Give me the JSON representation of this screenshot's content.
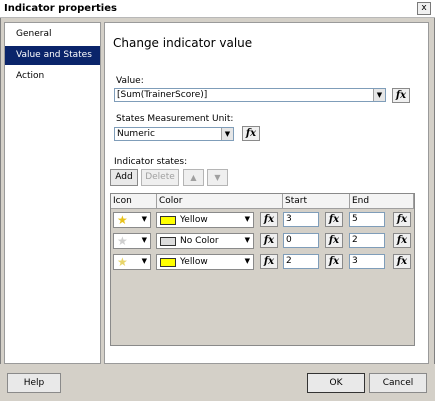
{
  "window": {
    "title": "Indicator properties",
    "close": "x"
  },
  "nav": {
    "items": [
      "General",
      "Value and States",
      "Action"
    ]
  },
  "main": {
    "title": "Change indicator value"
  },
  "value": {
    "label": "Value:",
    "expression": "[Sum(TrainerScore)]"
  },
  "units": {
    "label": "States Measurement Unit:",
    "selected": "Numeric"
  },
  "states": {
    "label": "Indicator states:",
    "add_label": "Add",
    "delete_label": "Delete",
    "columns": [
      "Icon",
      "Color",
      "Start",
      "End"
    ],
    "rows": [
      {
        "icon": "gold-star-icon",
        "color": "Yellow",
        "swatch": "#ffff00",
        "start": "3",
        "end": "5"
      },
      {
        "icon": "empty-star-icon",
        "color": "No Color",
        "swatch": "#dcdcdc",
        "start": "0",
        "end": "2"
      },
      {
        "icon": "half-star-icon",
        "color": "Yellow",
        "swatch": "#ffff00",
        "start": "2",
        "end": "3"
      }
    ]
  },
  "footer": {
    "help": "Help",
    "ok": "OK",
    "cancel": "Cancel"
  },
  "fx": "fx"
}
